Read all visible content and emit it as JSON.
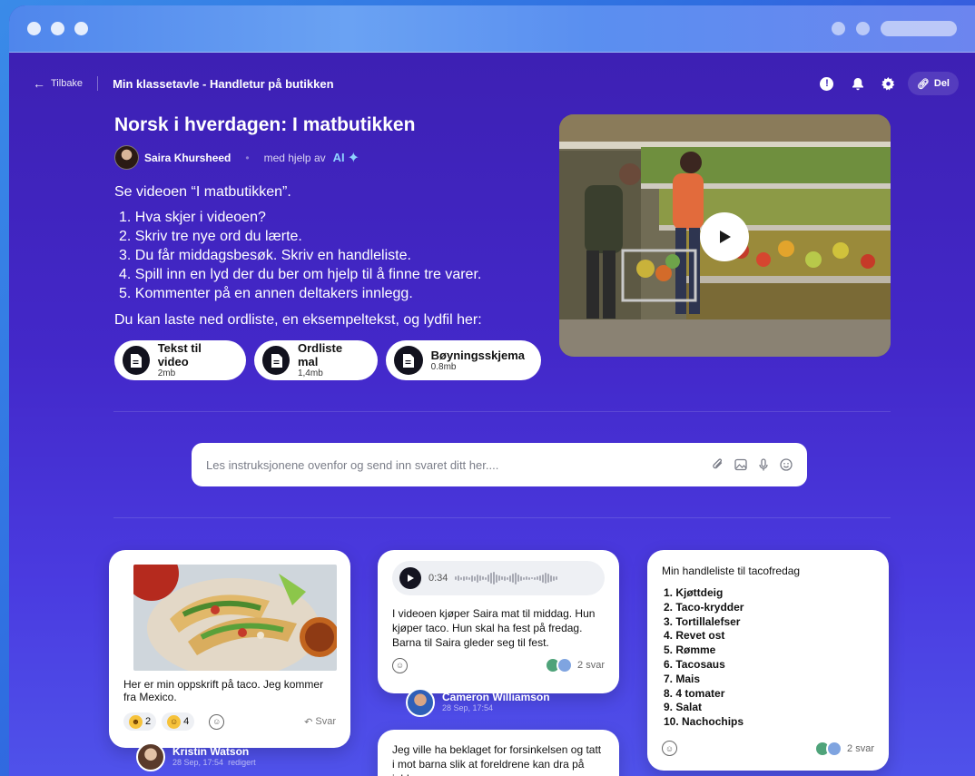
{
  "topbar": {
    "back_label": "Tilbake",
    "board_title": "Min klassetavle - Handletur på butikken",
    "share_label": "Del"
  },
  "post": {
    "title": "Norsk i hverdagen: I matbutikken",
    "author": "Saira Khursheed",
    "with_help": "med hjelp av",
    "ai_label": "AI",
    "lead": "Se videoen “I matbutikken”.",
    "tasks": [
      "1. Hva skjer i videoen?",
      "2. Skriv tre nye ord du lærte.",
      "3. Du får middagsbesøk. Skriv en handleliste.",
      "4. Spill inn en lyd der du ber om hjelp til å finne tre varer.",
      "5. Kommenter på en annen deltakers innlegg."
    ],
    "download_text": "Du kan laste ned ordliste, en eksempeltekst, og lydfil her:",
    "files": [
      {
        "title": "Tekst til video",
        "size": "2mb"
      },
      {
        "title": "Ordliste mal",
        "size": "1,4mb"
      },
      {
        "title": "Bøyningsskjema",
        "size": "0.8mb"
      }
    ]
  },
  "answer": {
    "placeholder": "Les instruksjonene ovenfor og send inn svaret ditt her...."
  },
  "cards": {
    "recipe": {
      "text": "Her er min oppskrift på taco. Jeg kommer fra Mexico.",
      "reactions": [
        {
          "count": "2"
        },
        {
          "count": "4"
        }
      ],
      "reply_label": "Svar",
      "author": "Kristin Watson",
      "date": "28 Sep, 17:54",
      "edited": "redigert"
    },
    "audio": {
      "time": "0:34",
      "text": "I videoen kjøper Saira mat til middag. Hun kjøper taco. Hun skal ha fest på fredag. Barna til Saira gleder seg til fest.",
      "replies": "2 svar",
      "author": "Cameron Williamson",
      "date": "28 Sep, 17:54"
    },
    "apology": {
      "text": "Jeg ville ha beklaget for forsinkelsen og tatt i mot barna slik at foreldrene kan dra på jobb."
    },
    "list": {
      "title": "Min handleliste til tacofredag",
      "items": [
        "1. Kjøttdeig",
        "2. Taco-krydder",
        "3. Tortillalefser",
        "4. Revet ost",
        "5. Rømme",
        "6. Tacosaus",
        "7. Mais",
        "8. 4 tomater",
        "9. Salat",
        "10. Nachochips"
      ],
      "replies": "2 svar"
    }
  }
}
